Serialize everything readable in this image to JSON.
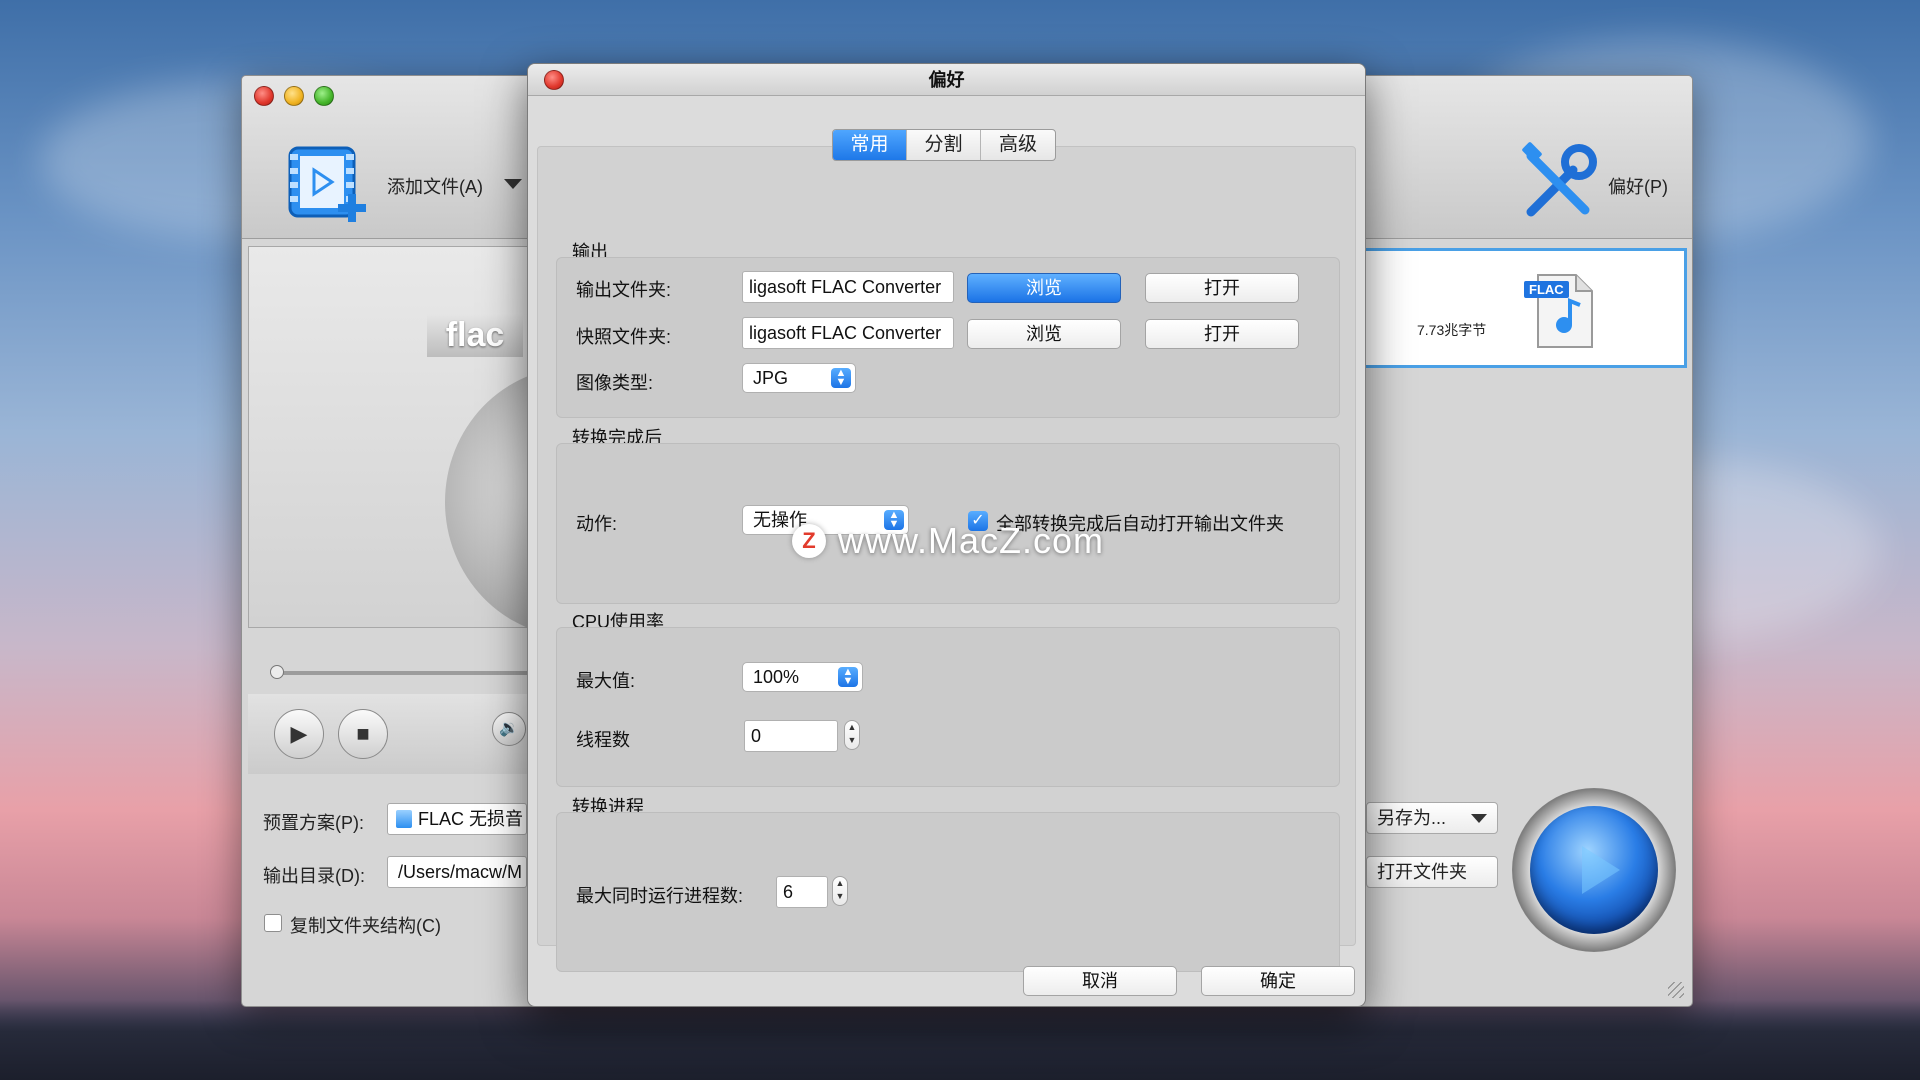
{
  "main_window": {
    "toolbar": {
      "add_file_label": "添加文件(A)",
      "preferences_label": "偏好(P)"
    },
    "preview": {
      "format_tag": "flac"
    },
    "file_list": {
      "file_size": "7.73兆字节",
      "file_badge": "FLAC"
    },
    "bottom": {
      "preset_label": "预置方案(P):",
      "preset_value": "FLAC 无损音",
      "output_dir_label": "输出目录(D):",
      "output_dir_value": "/Users/macw/M",
      "copy_structure_label": "复制文件夹结构(C)",
      "save_as_label": "另存为...",
      "open_folder_label": "打开文件夹"
    }
  },
  "dialog": {
    "title": "偏好",
    "tabs": [
      {
        "label": "常用",
        "active": true
      },
      {
        "label": "分割",
        "active": false
      },
      {
        "label": "高级",
        "active": false
      }
    ],
    "output": {
      "group_title": "输出",
      "output_folder_label": "输出文件夹:",
      "output_folder_value": "ligasoft FLAC Converter",
      "snapshot_folder_label": "快照文件夹:",
      "snapshot_folder_value": "ligasoft FLAC Converter",
      "browse_label": "浏览",
      "open_label": "打开",
      "image_type_label": "图像类型:",
      "image_type_value": "JPG"
    },
    "after_conversion": {
      "group_title": "转换完成后",
      "action_label": "动作:",
      "action_value": "无操作",
      "auto_open_label": "全部转换完成后自动打开输出文件夹",
      "auto_open_checked": true
    },
    "cpu": {
      "group_title": "CPU使用率",
      "max_label": "最大值:",
      "max_value": "100%",
      "threads_label": "线程数",
      "threads_value": "0"
    },
    "progress": {
      "group_title": "转换进程",
      "max_processes_label": "最大同时运行进程数:",
      "max_processes_value": "6"
    },
    "footer": {
      "cancel_label": "取消",
      "ok_label": "确定"
    }
  },
  "watermark": {
    "logo_letter": "Z",
    "text": "www.MacZ.com"
  },
  "colors": {
    "accent_blue": "#1e78e8",
    "selection_border": "#4aa0e6"
  }
}
